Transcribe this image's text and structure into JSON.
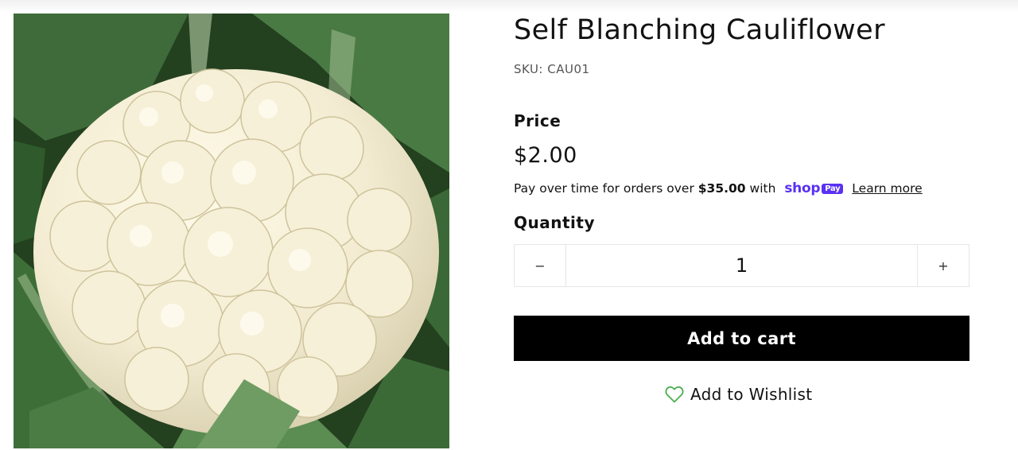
{
  "product": {
    "title": "Self Blanching Cauliflower",
    "sku": "SKU: CAU01",
    "image_alt": "Cauliflower head surrounded by green leaves"
  },
  "price": {
    "label": "Price",
    "value": "$2.00"
  },
  "installments": {
    "text_before": "Pay over time for orders over",
    "threshold": "$35.00",
    "text_with": "with",
    "brand_shop": "shop",
    "brand_pay": "Pay",
    "learn_more": "Learn more"
  },
  "quantity": {
    "label": "Quantity",
    "value": "1",
    "decrease_symbol": "−",
    "increase_symbol": "+"
  },
  "actions": {
    "add_to_cart": "Add to cart",
    "wishlist": "Add to Wishlist"
  },
  "icons": {
    "wishlist": "heart-icon"
  },
  "colors": {
    "accent_shop": "#5a31f4",
    "cart_button": "#000000",
    "heart_outline": "#4caf50"
  }
}
